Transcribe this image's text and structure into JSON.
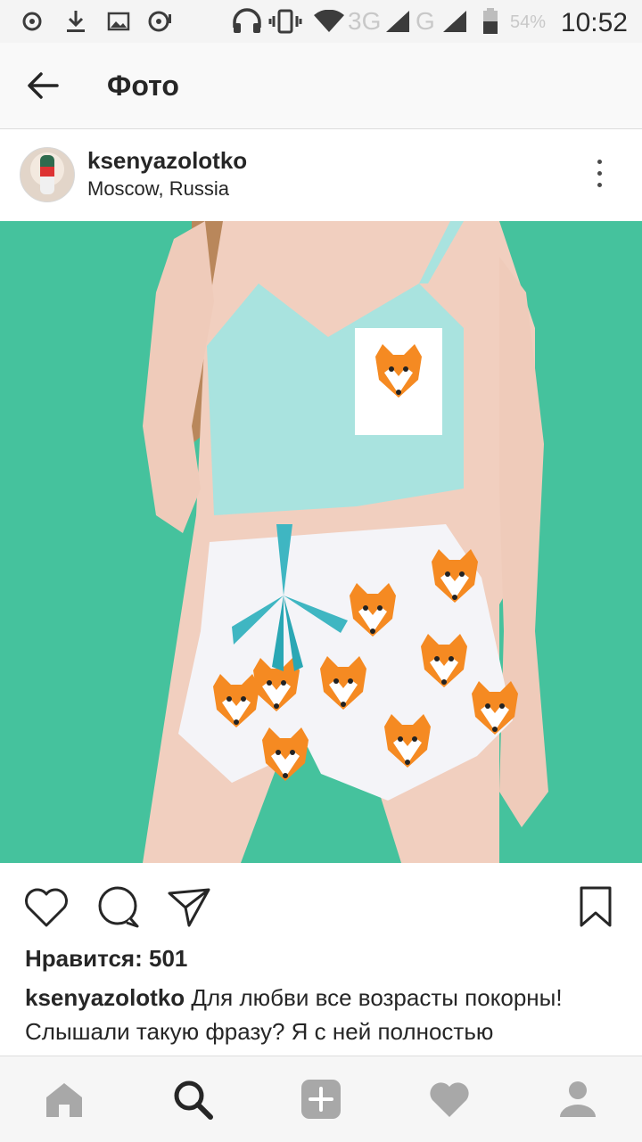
{
  "status_bar": {
    "time": "10:52",
    "battery": "54%",
    "network_1": "3G",
    "network_2": "G",
    "icons": [
      "settings-icon",
      "download-icon",
      "gallery-icon",
      "headset-icon",
      "vibrate-icon",
      "wifi-icon",
      "signal-icon",
      "battery-icon"
    ]
  },
  "app_bar": {
    "title": "Фото",
    "back_icon": "back-arrow-icon"
  },
  "post": {
    "username": "ksenyazolotko",
    "location": "Moscow, Russia",
    "photo_description": "",
    "likes": "Нравится: 501",
    "caption_user": "ksenyazolotko",
    "caption_text": " Для любви все возрасты покорны! Слышали такую фразу? Я с ней полностью"
  },
  "actions": [
    "heart-icon",
    "comment-icon",
    "share-icon",
    "bookmark-icon"
  ],
  "bottom_nav": [
    "home-icon",
    "search-icon",
    "add-icon",
    "activity-heart-icon",
    "profile-icon"
  ],
  "colors": {
    "photo_background": "#45c29d",
    "top": "#a9e3df",
    "fox": "#f58a22"
  }
}
